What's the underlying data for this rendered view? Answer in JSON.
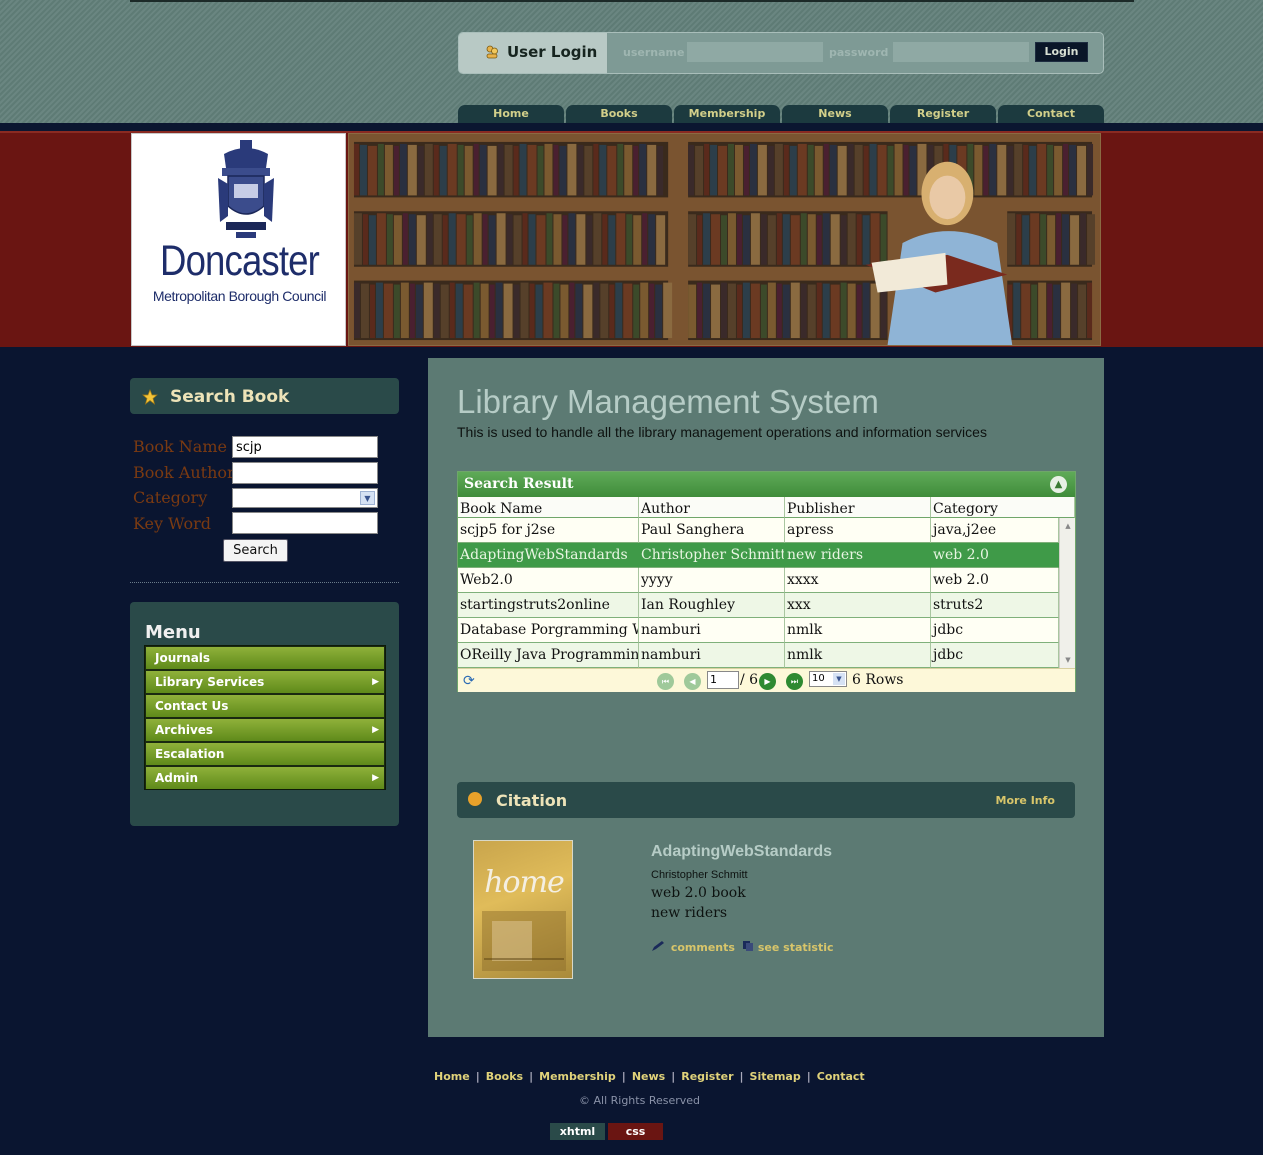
{
  "login": {
    "title": "User Login",
    "username_label": "username",
    "password_label": "password",
    "button": "Login"
  },
  "nav": [
    "Home",
    "Books",
    "Membership",
    "News",
    "Register",
    "Contact"
  ],
  "logo": {
    "name": "Doncaster",
    "subtitle": "Metropolitan Borough Council"
  },
  "search": {
    "title": "Search Book",
    "book_name_label": "Book Name",
    "book_name_value": "scjp",
    "book_author_label": "Book Author",
    "category_label": "Category",
    "keyword_label": "Key Word",
    "button": "Search"
  },
  "menu": {
    "title": "Menu",
    "items": [
      {
        "label": "Journals",
        "has_submenu": false
      },
      {
        "label": "Library Services",
        "has_submenu": true
      },
      {
        "label": "Contact Us",
        "has_submenu": false
      },
      {
        "label": "Archives",
        "has_submenu": true
      },
      {
        "label": "Escalation",
        "has_submenu": false
      },
      {
        "label": "Admin",
        "has_submenu": true
      }
    ]
  },
  "main": {
    "heading": "Library Management System",
    "description": "This is used to handle all the library management operations and information services"
  },
  "grid": {
    "title": "Search Result",
    "columns": [
      "Book Name",
      "Author",
      "Publisher",
      "Category"
    ],
    "rows": [
      [
        "scjp5 for j2se",
        "Paul Sanghera",
        "apress",
        "java,j2ee"
      ],
      [
        "AdaptingWebStandards",
        "Christopher Schmitt",
        "new riders",
        "web 2.0"
      ],
      [
        "Web2.0",
        "yyyy",
        "xxxx",
        "web 2.0"
      ],
      [
        "startingstruts2online",
        "Ian Roughley",
        "xxx",
        "struts2"
      ],
      [
        "Database Porgramming With",
        "namburi",
        "nmlk",
        "jdbc"
      ],
      [
        "OReilly Java Programming wi",
        "namburi",
        "nmlk",
        "jdbc"
      ]
    ],
    "selected_row": 1,
    "pager": {
      "page": "1",
      "total": "/ 6",
      "page_size": "10",
      "rows_text": "6 Rows"
    }
  },
  "citation": {
    "title": "Citation",
    "more": "More Info",
    "cover_text": "home",
    "book_title": "AdaptingWebStandards",
    "author": "Christopher Schmitt",
    "category_line": "web 2.0 book",
    "publisher": "new riders",
    "comments": "comments",
    "statistic": "see statistic"
  },
  "footer": {
    "links": [
      "Home",
      "Books",
      "Membership",
      "News",
      "Register",
      "Sitemap",
      "Contact"
    ],
    "copyright": "© All Rights Reserved",
    "badge_xhtml": "xhtml",
    "badge_css": "css"
  },
  "colors": {
    "header_bg": "#62807a",
    "panel_bg": "#5c7a73",
    "page_bg": "#0a1530",
    "banner_red": "#6a1512",
    "menu_green": "#7aa22c",
    "grid_green": "#3f9a48",
    "accent_gold": "#d8c56a"
  }
}
